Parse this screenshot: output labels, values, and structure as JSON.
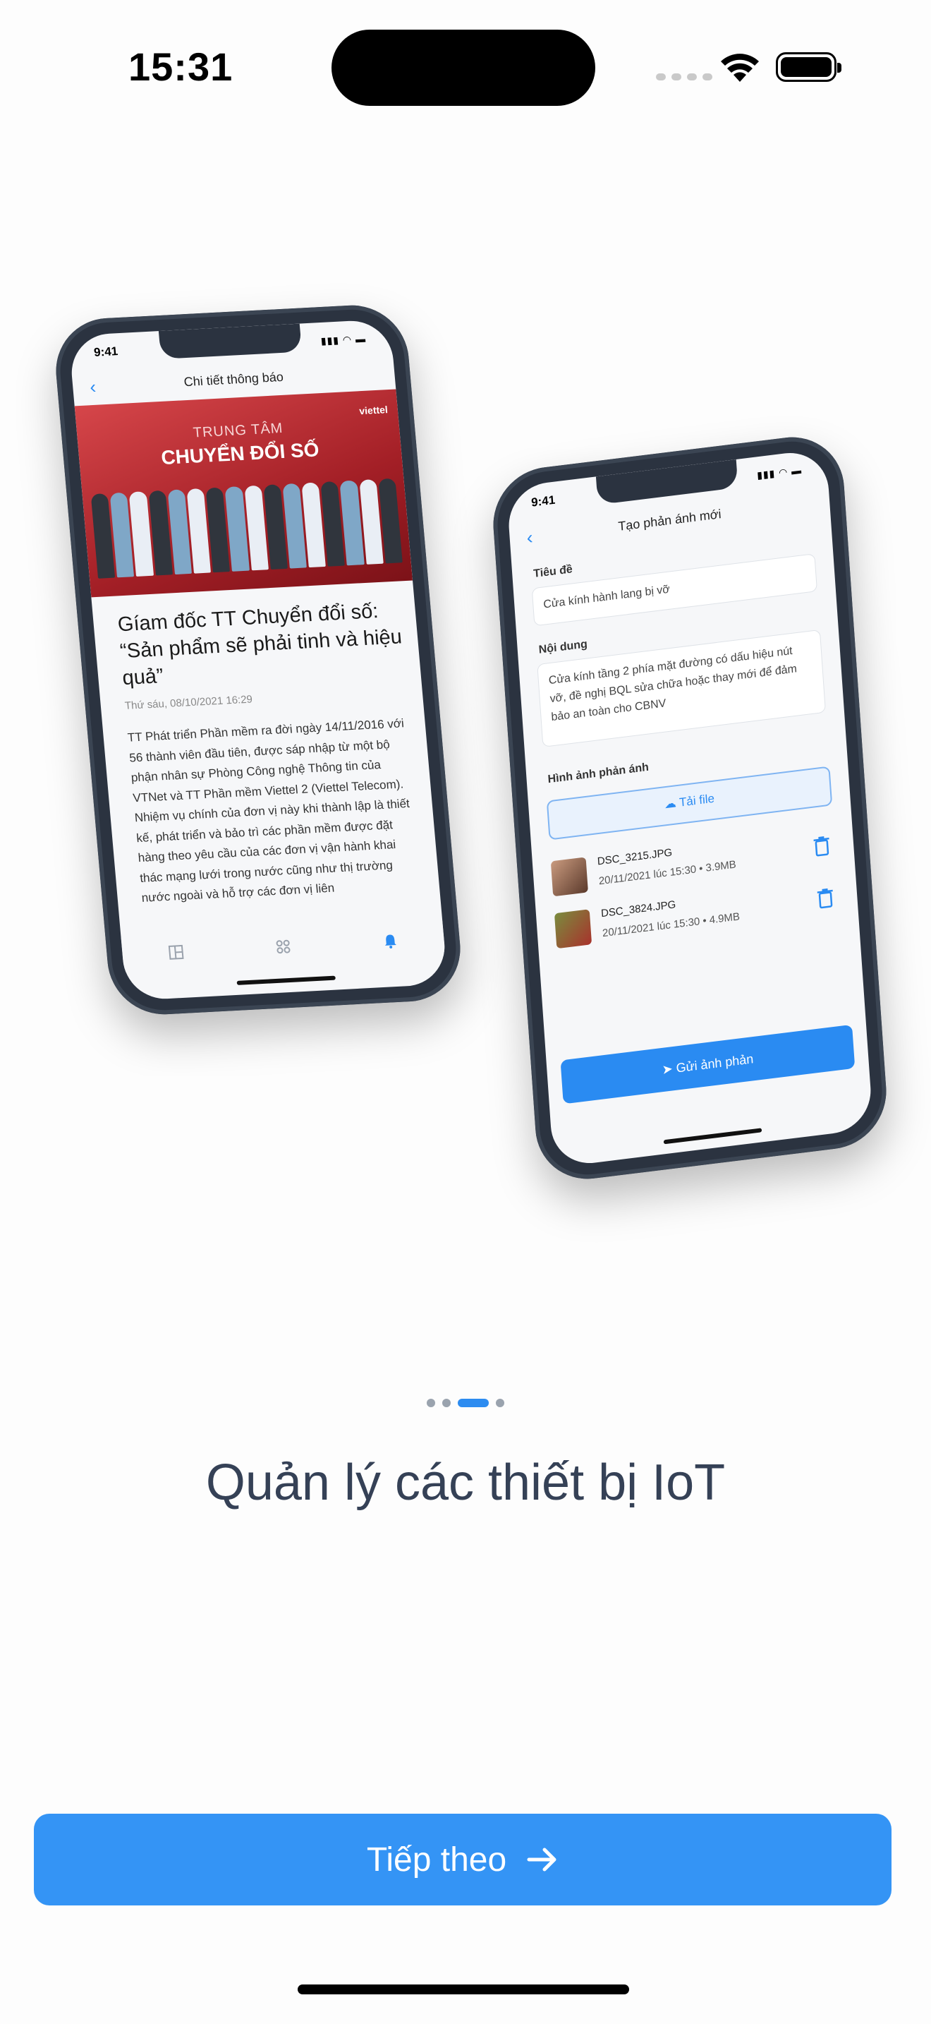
{
  "status_bar": {
    "time": "15:31"
  },
  "mock_news": {
    "time": "9:41",
    "header": "Chi tiết thông báo",
    "hero_line1": "TRUNG TÂM",
    "hero_line2": "CHUYỂN ĐỔI SỐ",
    "brand": "viettel",
    "title": "Gíam đốc TT Chuyển đổi số: “Sản phẩm sẽ phải tinh và hiệu quả”",
    "date": "Thứ sáu, 08/10/2021 16:29",
    "body": "TT Phát triển Phần mềm ra đời ngày 14/11/2016 với 56 thành viên đầu tiên, được sáp nhập từ một bộ phận nhân sự Phòng Công nghệ Thông tin của VTNet và TT Phần mềm Viettel 2 (Viettel Telecom). Nhiệm vụ chính của đơn vị này khi thành lập là thiết kế, phát triển và bảo trì các phần mềm được đặt hàng theo yêu cầu của các đơn vị vận hành khai thác mạng lưới trong nước cũng như thị trường nước ngoài và hỗ trợ các đơn vị liên"
  },
  "mock_report": {
    "time": "9:41",
    "header": "Tạo phản ánh mới",
    "title_label": "Tiêu đề",
    "title_value": "Cửa kính hành lang bị vỡ",
    "content_label": "Nội dung",
    "content_value": "Cửa kính tầng 2 phía mặt đường có dấu hiệu nút vỡ, đề nghị BQL sửa chữa hoặc thay mới để đảm bảo an toàn cho CBNV",
    "images_label": "Hình ảnh phản ánh",
    "upload_label": "Tải file",
    "files": [
      {
        "name": "DSC_3215.JPG",
        "meta": "20/11/2021 lúc 15:30  •  3.9MB"
      },
      {
        "name": "DSC_3824.JPG",
        "meta": "20/11/2021 lúc 15:30  •  4.9MB"
      }
    ],
    "send_label": "Gửi ảnh phản"
  },
  "onboarding": {
    "title": "Quản lý các thiết bị IoT",
    "page_count": 4,
    "active_page": 3,
    "next_label": "Tiếp theo"
  },
  "colors": {
    "accent": "#3494f5",
    "title": "#354156"
  }
}
